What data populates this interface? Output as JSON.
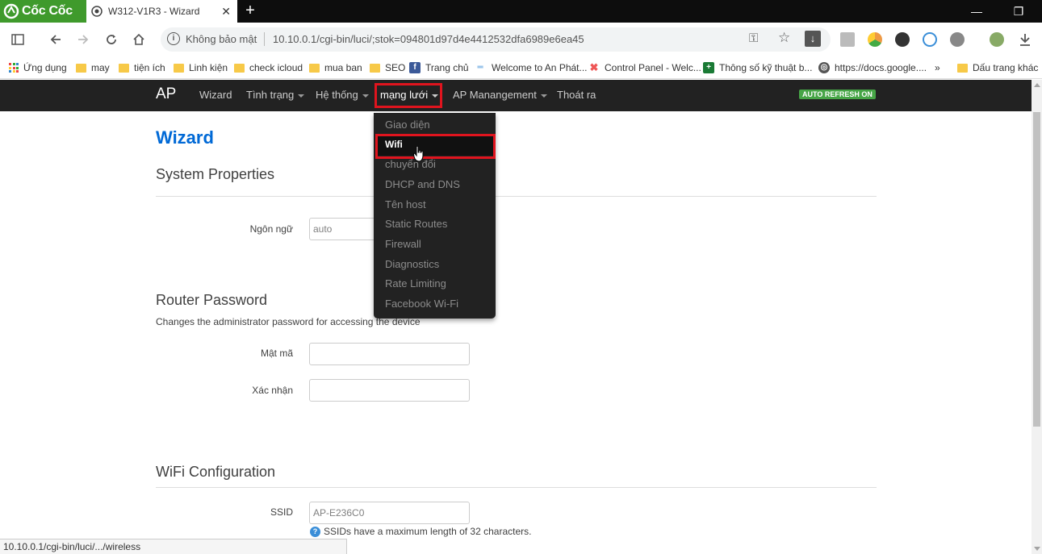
{
  "browser": {
    "name": "Cốc Cốc",
    "tab_title": "W312-V1R3 - Wizard",
    "tab_close": "✕",
    "new_tab": "+",
    "window": {
      "minimize": "—",
      "restore": "❐"
    },
    "security_label": "Không bảo mật",
    "url": "10.10.0.1/cgi-bin/luci/;stok=094801d97d4e4412532dfa6989e6ea45",
    "status_url": "10.10.0.1/cgi-bin/luci/.../wireless"
  },
  "bookmarks": {
    "items": [
      {
        "label": "Ứng dụng",
        "icon": "apps-grid-icon"
      },
      {
        "label": "may",
        "icon": "folder-icon"
      },
      {
        "label": "tiện ích",
        "icon": "folder-icon"
      },
      {
        "label": "Linh kiện",
        "icon": "folder-icon"
      },
      {
        "label": "check icloud",
        "icon": "folder-icon"
      },
      {
        "label": "mua ban",
        "icon": "folder-icon"
      },
      {
        "label": "SEO",
        "icon": "folder-icon"
      },
      {
        "label": "Trang chủ",
        "icon": "facebook-icon"
      },
      {
        "label": "Welcome to An Phát...",
        "icon": "anphat-icon"
      },
      {
        "label": "Control Panel - Welc...",
        "icon": "joomla-icon"
      },
      {
        "label": "Thông số kỹ thuật b...",
        "icon": "cross-icon"
      },
      {
        "label": "https://docs.google....",
        "icon": "globe-icon"
      }
    ],
    "more": "»",
    "other": "Dấu trang khác"
  },
  "luci": {
    "brand": "AP",
    "nav": {
      "wizard": "Wizard",
      "status": "Tình trạng",
      "system": "Hệ thống",
      "network": "mạng lưới",
      "ap_management": "AP Manangement",
      "logout": "Thoát ra"
    },
    "auto_refresh": "AUTO REFRESH ON",
    "network_menu": [
      "Giao diện",
      "Wifi",
      "chuyển đổi",
      "DHCP and DNS",
      "Tên host",
      "Static Routes",
      "Firewall",
      "Diagnostics",
      "Rate Limiting",
      "Facebook Wi-Fi"
    ],
    "active_menu_item": "Wifi",
    "page_title": "Wizard",
    "system_properties": {
      "title": "System Properties",
      "language_label": "Ngôn ngữ",
      "language_value": "auto"
    },
    "router_password": {
      "title": "Router Password",
      "description": "Changes the administrator password for accessing the device",
      "password_label": "Mật mã",
      "confirm_label": "Xác nhận"
    },
    "wifi_configuration": {
      "title": "WiFi Configuration",
      "ssid_label": "SSID",
      "ssid_value": "AP-E236C0",
      "ssid_hint": "SSIDs have a maximum length of 32 characters."
    }
  },
  "colors": {
    "navbar": "#222222",
    "title_blue": "#0069d6",
    "highlight_red": "#e0141e",
    "badge_green": "#46a546",
    "browser_green": "#3f9a2c"
  }
}
